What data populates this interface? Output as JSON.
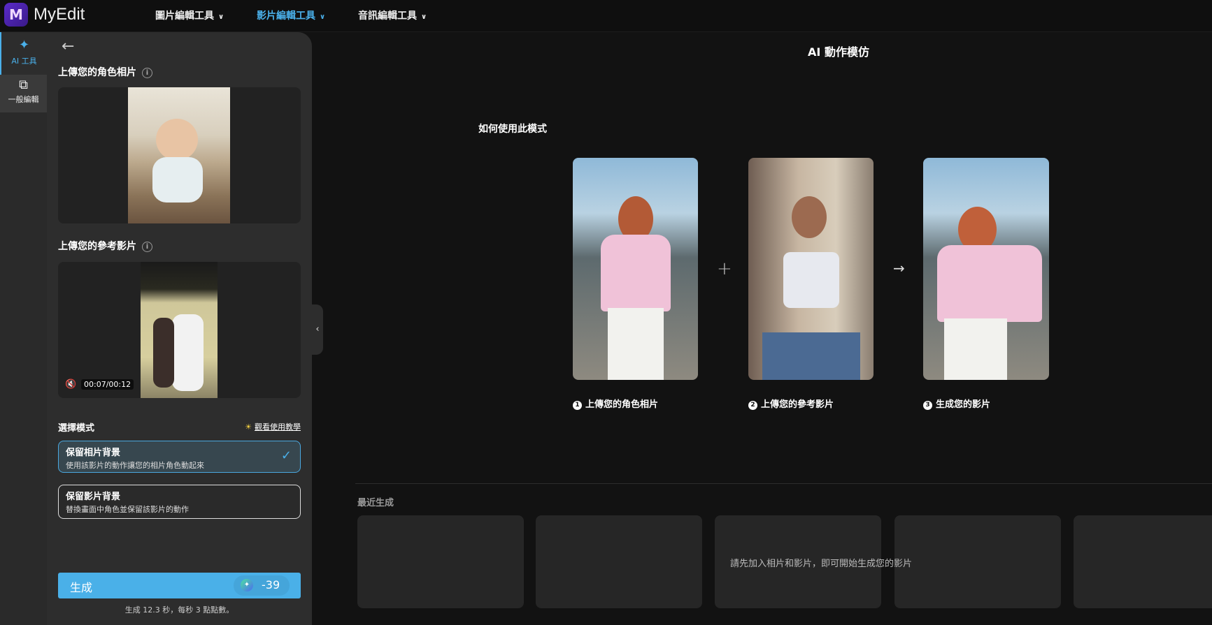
{
  "header": {
    "logo_text": "MyEdit",
    "nav": [
      {
        "label": "圖片編輯工具"
      },
      {
        "label": "影片編輯工具",
        "active": true
      },
      {
        "label": "音訊編輯工具"
      }
    ]
  },
  "rail": {
    "items": [
      {
        "label": "AI 工具",
        "icon": "magic-wand-icon"
      },
      {
        "label": "一般編輯",
        "icon": "layers-icon"
      }
    ]
  },
  "panel": {
    "photo_heading": "上傳您的角色相片",
    "video_heading": "上傳您的參考影片",
    "video_time": "00:07/00:12",
    "mode_heading": "選擇模式",
    "tutorial_link": "觀看使用教學",
    "options": [
      {
        "title": "保留相片背景",
        "desc": "使用該影片的動作讓您的相片角色動起來",
        "selected": true
      },
      {
        "title": "保留影片背景",
        "desc": "替換畫面中角色並保留該影片的動作",
        "selected": false
      }
    ],
    "generate_label": "生成",
    "credit_cost": "-39",
    "footnote": "生成 12.3 秒，每秒 3 點點數。"
  },
  "main": {
    "title": "AI 動作模仿",
    "howto": "如何使用此模式",
    "steps": [
      {
        "num": "1",
        "label": "上傳您的角色相片"
      },
      {
        "num": "2",
        "label": "上傳您的參考影片"
      },
      {
        "num": "3",
        "label": "生成您的影片"
      }
    ],
    "recent_heading": "最近生成",
    "empty_message": "請先加入相片和影片，即可開始生成您的影片"
  },
  "colors": {
    "accent": "#4ab0e8",
    "background": "#121212",
    "panel": "#2d2d2d"
  }
}
